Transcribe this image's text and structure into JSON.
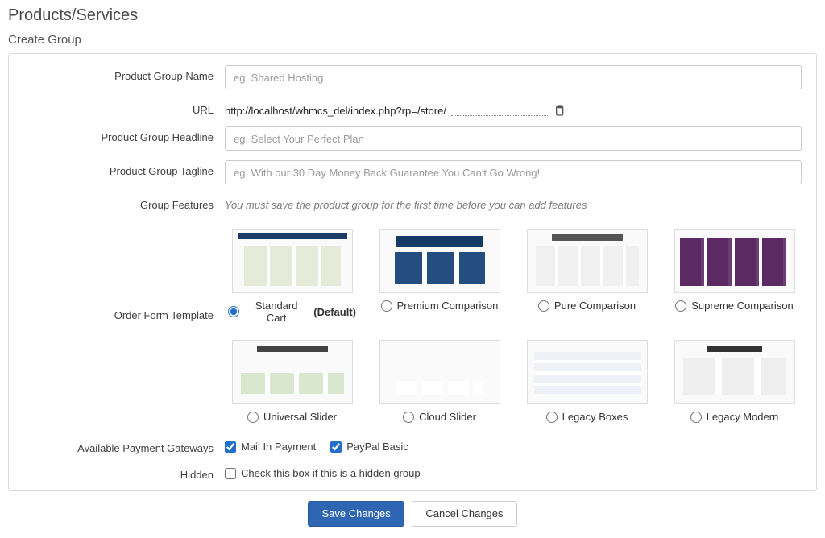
{
  "page": {
    "title": "Products/Services",
    "sub_title": "Create Group"
  },
  "labels": {
    "group_name": "Product Group Name",
    "url": "URL",
    "headline": "Product Group Headline",
    "tagline": "Product Group Tagline",
    "features": "Group Features",
    "template": "Order Form Template",
    "gateways": "Available Payment Gateways",
    "hidden": "Hidden"
  },
  "fields": {
    "group_name": {
      "value": "",
      "placeholder": "eg. Shared Hosting"
    },
    "url": {
      "base": "http://localhost/whmcs_del/index.php?rp=/store/",
      "slug": ""
    },
    "headline": {
      "value": "",
      "placeholder": "eg. Select Your Perfect Plan"
    },
    "tagline": {
      "value": "",
      "placeholder": "eg. With our 30 Day Money Back Guarantee You Can't Go Wrong!"
    },
    "features_hint": "You must save the product group for the first time before you can add features"
  },
  "templates": [
    {
      "key": "standard",
      "label": "Standard Cart",
      "default_suffix": " (Default)",
      "selected": true,
      "thumb_class": "th-standard"
    },
    {
      "key": "premium",
      "label": "Premium Comparison",
      "default_suffix": "",
      "selected": false,
      "thumb_class": "th-premium"
    },
    {
      "key": "pure",
      "label": "Pure Comparison",
      "default_suffix": "",
      "selected": false,
      "thumb_class": "th-pure"
    },
    {
      "key": "supreme",
      "label": "Supreme Comparison",
      "default_suffix": "",
      "selected": false,
      "thumb_class": "th-supreme"
    },
    {
      "key": "universal",
      "label": "Universal Slider",
      "default_suffix": "",
      "selected": false,
      "thumb_class": "th-univ"
    },
    {
      "key": "cloud",
      "label": "Cloud Slider",
      "default_suffix": "",
      "selected": false,
      "thumb_class": "th-cloud"
    },
    {
      "key": "legacy",
      "label": "Legacy Boxes",
      "default_suffix": "",
      "selected": false,
      "thumb_class": "th-legacy"
    },
    {
      "key": "legacymod",
      "label": "Legacy Modern",
      "default_suffix": "",
      "selected": false,
      "thumb_class": "th-legacymod"
    }
  ],
  "gateways": [
    {
      "key": "mailin",
      "label": "Mail In Payment",
      "checked": true
    },
    {
      "key": "paypal",
      "label": "PayPal Basic",
      "checked": true
    }
  ],
  "hidden": {
    "label": "Check this box if this is a hidden group",
    "checked": false
  },
  "buttons": {
    "save": "Save Changes",
    "cancel": "Cancel Changes"
  }
}
